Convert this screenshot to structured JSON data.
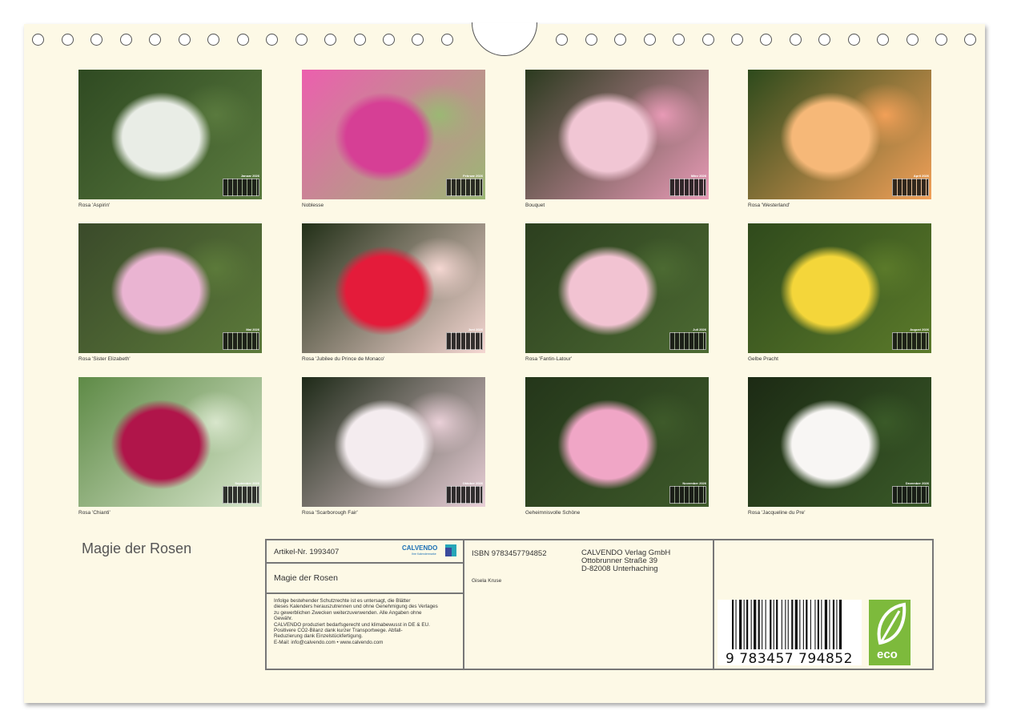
{
  "months": [
    {
      "month": "Januar 2026",
      "caption": "Rosa 'Aspirin'",
      "bg": [
        "#2f4a22",
        "#e9ede6",
        "#5a7a3e"
      ]
    },
    {
      "month": "Februar 2026",
      "caption": "Noblesse",
      "bg": [
        "#ec5fae",
        "#d63f95",
        "#9bb874"
      ]
    },
    {
      "month": "März 2026",
      "caption": "Bouquet",
      "bg": [
        "#2b3a1f",
        "#f1c6d4",
        "#e89ab6"
      ]
    },
    {
      "month": "April 2026",
      "caption": "Rosa 'Westerland'",
      "bg": [
        "#2d4a1c",
        "#f6b878",
        "#f2a058"
      ]
    },
    {
      "month": "Mai 2026",
      "caption": "Rosa 'Sister Elizabeth'",
      "bg": [
        "#3a4a2a",
        "#eab4d2",
        "#5c7a3a"
      ]
    },
    {
      "month": "Juni 2026",
      "caption": "Rosa 'Jubilee du Prince de Monaco'",
      "bg": [
        "#223018",
        "#e41b3a",
        "#f5d7d2"
      ]
    },
    {
      "month": "Juli 2026",
      "caption": "Rosa 'Fantin-Latour'",
      "bg": [
        "#2c3f1f",
        "#f2c3d2",
        "#4c6a32"
      ]
    },
    {
      "month": "August 2026",
      "caption": "Gelbe Pracht",
      "bg": [
        "#2f4a1c",
        "#f4d63a",
        "#5b7a2a"
      ]
    },
    {
      "month": "September 2026",
      "caption": "Rosa 'Chianti'",
      "bg": [
        "#5e8a46",
        "#b0154a",
        "#d8e6cc"
      ]
    },
    {
      "month": "Oktober 2026",
      "caption": "Rosa 'Scarborough Fair'",
      "bg": [
        "#1e2a18",
        "#f4ecef",
        "#ead0d8"
      ]
    },
    {
      "month": "November 2026",
      "caption": "Geheimnisvolle Schöne",
      "bg": [
        "#24361a",
        "#f0a6c6",
        "#3e5a2a"
      ]
    },
    {
      "month": "Dezember 2026",
      "caption": "Rosa 'Jacqueline du Pre'",
      "bg": [
        "#1c2a14",
        "#f8f6f4",
        "#3a5a28"
      ]
    }
  ],
  "title": "Magie der Rosen",
  "info": {
    "article": "Artikel-Nr. 1993407",
    "logo_text": "CALVENDO",
    "logo_sub": "Ihre Kalendermarke",
    "title": "Magie der Rosen",
    "legal": [
      "Infolge bestehender Schutzrechte ist es untersagt, die Blätter",
      "dieses Kalenders herauszutrennen und ohne Genehmigung des Verlages",
      "zu gewerblichen Zwecken weiterzuverwenden. Alle Angaben ohne",
      "Gewähr.",
      "CALVENDO produziert bedarfsgerecht und klimabewusst in DE & EU.",
      "Positivere CO2-Bilanz dank kurzer Transportwege. Abfall-",
      "Reduzierung dank Einzelstückfertigung.",
      "E-Mail: info@calvendo.com • www.calvendo.com"
    ],
    "isbn": "ISBN 9783457794852",
    "publisher": [
      "CALVENDO Verlag GmbH",
      "Ottobrunner Straße 39",
      "D-82008 Unterhaching"
    ],
    "author": "Gisela Kruse",
    "barcode_number": "9 783457 794852",
    "eco_label": "eco"
  }
}
